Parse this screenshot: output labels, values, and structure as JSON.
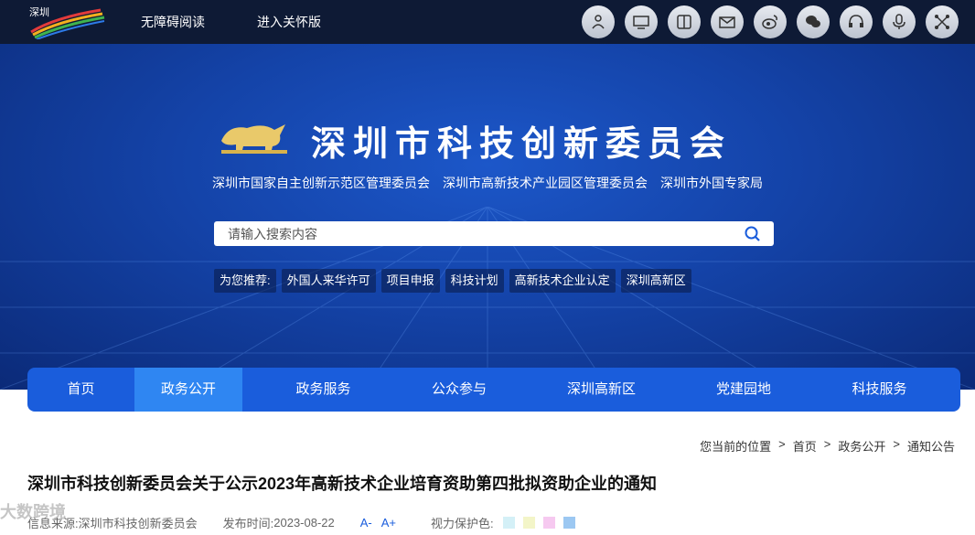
{
  "topbar": {
    "logo_alt": "深圳 SHENZHEN CHINA",
    "links": [
      "无障碍阅读",
      "进入关怀版"
    ],
    "icons": [
      "robot-icon",
      "monitor-icon",
      "reader-icon",
      "mail-icon",
      "weibo-icon",
      "wechat-icon",
      "headset-icon",
      "microphone-icon",
      "network-icon"
    ]
  },
  "banner": {
    "title": "深圳市科技创新委员会",
    "subtitles": [
      "深圳市国家自主创新示范区管理委员会",
      "深圳市高新技术产业园区管理委员会",
      "深圳市外国专家局"
    ],
    "search": {
      "placeholder": "请输入搜索内容"
    },
    "recommend_label": "为您推荐:",
    "recommend_tags": [
      "外国人来华许可",
      "项目申报",
      "科技计划",
      "高新技术企业认定",
      "深圳高新区"
    ]
  },
  "nav": {
    "items": [
      "首页",
      "政务公开",
      "政务服务",
      "公众参与",
      "深圳高新区",
      "党建园地",
      "科技服务"
    ],
    "active_index": 1
  },
  "breadcrumb": {
    "prefix": "您当前的位置",
    "items": [
      "首页",
      "政务公开",
      "通知公告"
    ]
  },
  "article": {
    "title": "深圳市科技创新委员会关于公示2023年高新技术企业培育资助第四批拟资助企业的通知",
    "source_label": "信息来源:",
    "source": "深圳市科技创新委员会",
    "date_label": "发布时间:",
    "date": "2023-08-22",
    "font_smaller": "A-",
    "font_larger": "A+",
    "vision_label": "视力保护色:"
  },
  "colors": {
    "topbar": "#0e1a35",
    "nav": "#1a5ddc",
    "nav_active": "#2f86f2",
    "swatches": [
      "#d4f0f7",
      "#f3f5c8",
      "#f6c9f0",
      "#9cc8f2"
    ]
  },
  "watermark": "大数跨境"
}
